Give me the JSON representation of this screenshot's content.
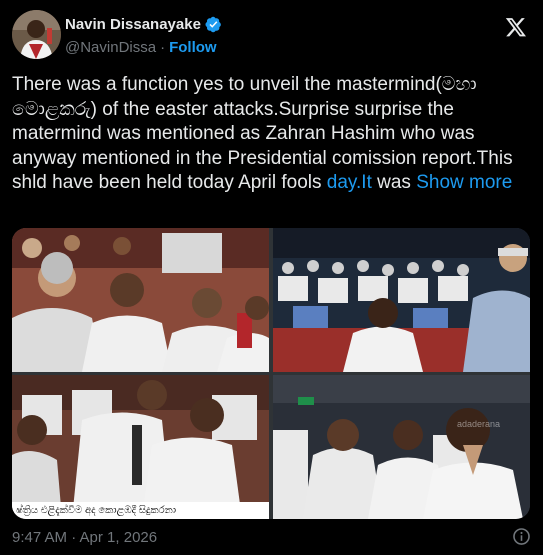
{
  "author": {
    "name": "Navin Dissanayake",
    "handle": "@NavinDissa",
    "follow_label": "Follow",
    "separator": "·"
  },
  "tweet": {
    "text_before_link": "There was a function yes to unveil the mastermind(මහා මොළකරු) of the easter attacks.Surprise surprise the matermind was mentioned as Zahran Hashim who was anyway mentioned in the Presidential comission report.This shld have been held today April fools ",
    "link_text": "day.It",
    "text_after_link": " was ",
    "show_more": "Show more"
  },
  "media": {
    "caption_bottom_left": "ෂ්ත්‍රිය එළිදැක්වීම අද කොළඹදී සිදුකරනා",
    "watermark": "adaderana"
  },
  "footer": {
    "timestamp": "9:47 AM · Apr 1, 2026"
  },
  "icons": [
    "verified-badge-icon",
    "x-logo-icon",
    "info-icon"
  ],
  "colors": {
    "background": "#000000",
    "text": "#e7e9ea",
    "secondary": "#71767b",
    "accent": "#1d9bf0"
  }
}
